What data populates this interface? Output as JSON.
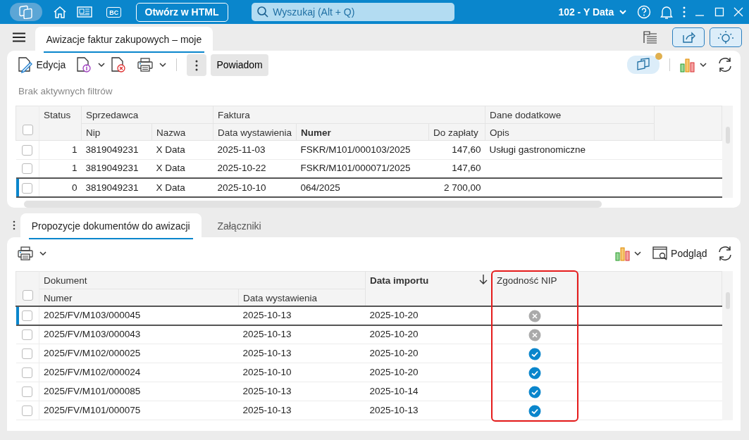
{
  "title_bar": {
    "bc_label": "BC",
    "open_html_button": "Otwórz w HTML",
    "search_placeholder": "Wyszukaj (Alt + Q)",
    "company": "102 - Y Data"
  },
  "tabs": [
    {
      "label": "Awizacje faktur zakupowych – moje",
      "selected": true
    }
  ],
  "toolbar": {
    "edit_button": "Edycja",
    "notify_button": "Powiadom",
    "sync_pending": true
  },
  "filter_status": "Brak aktywnych filtrów",
  "invoices": {
    "groups": [
      {
        "label": "Status",
        "kind": "number"
      },
      {
        "label": "Sprzedawca",
        "columns": [
          {
            "label": "Nip"
          },
          {
            "label": "Nazwa"
          }
        ]
      },
      {
        "label": "Faktura",
        "columns": [
          {
            "label": "Data wystawienia"
          },
          {
            "label": "Numer",
            "bold": true
          },
          {
            "label": "Do zapłaty",
            "kind": "number"
          }
        ]
      },
      {
        "label": "Dane dodatkowe",
        "columns": [
          {
            "label": "Opis"
          }
        ]
      }
    ],
    "all_checked": false,
    "rows": [
      {
        "checked": false,
        "selected": false,
        "cells": [
          "1",
          "3819049231",
          "X Data",
          "2025-11-03",
          "FSKR/M101/000103/2025",
          "147,60",
          "Usługi gastronomiczne"
        ]
      },
      {
        "checked": false,
        "selected": false,
        "cells": [
          "1",
          "3819049231",
          "X Data",
          "2025-10-22",
          "FSKR/M101/000071/2025",
          "147,60"
        ]
      },
      {
        "checked": false,
        "selected": true,
        "cells": [
          "0",
          "3819049231",
          "X Data",
          "2025-10-10",
          "064/2025",
          "2 700,00"
        ]
      }
    ]
  },
  "detail_tabs": [
    {
      "label": "Propozycje dokumentów do awizacji",
      "selected": true
    },
    {
      "label": "Załączniki",
      "selected": false
    }
  ],
  "detail_toolbar": {
    "preview_button": "Podgląd"
  },
  "proposals": {
    "groups": [
      {
        "label": "Dokument",
        "columns": [
          {
            "label": "Numer"
          },
          {
            "label": "Data wystawienia"
          }
        ]
      },
      {
        "label": "Data importu",
        "bold": true,
        "sort_descending": true
      },
      {
        "label": "Zgodność NIP",
        "highlighted": true,
        "kind": "status"
      }
    ],
    "all_checked": false,
    "rows": [
      {
        "checked": false,
        "selected": true,
        "cells": [
          "2025/FV/M103/000045",
          "2025-10-13",
          "2025-10-20"
        ],
        "nip_match": false
      },
      {
        "checked": false,
        "selected": false,
        "cells": [
          "2025/FV/M103/000043",
          "2025-10-13",
          "2025-10-20"
        ],
        "nip_match": false
      },
      {
        "checked": false,
        "selected": false,
        "cells": [
          "2025/FV/M102/000025",
          "2025-10-13",
          "2025-10-20"
        ],
        "nip_match": true
      },
      {
        "checked": false,
        "selected": false,
        "cells": [
          "2025/FV/M102/000024",
          "2025-10-10",
          "2025-10-20"
        ],
        "nip_match": true
      },
      {
        "checked": false,
        "selected": false,
        "cells": [
          "2025/FV/M101/000085",
          "2025-10-13",
          "2025-10-14"
        ],
        "nip_match": true
      },
      {
        "checked": false,
        "selected": false,
        "cells": [
          "2025/FV/M101/000075",
          "2025-10-13",
          "2025-10-13"
        ],
        "nip_match": true
      }
    ]
  }
}
